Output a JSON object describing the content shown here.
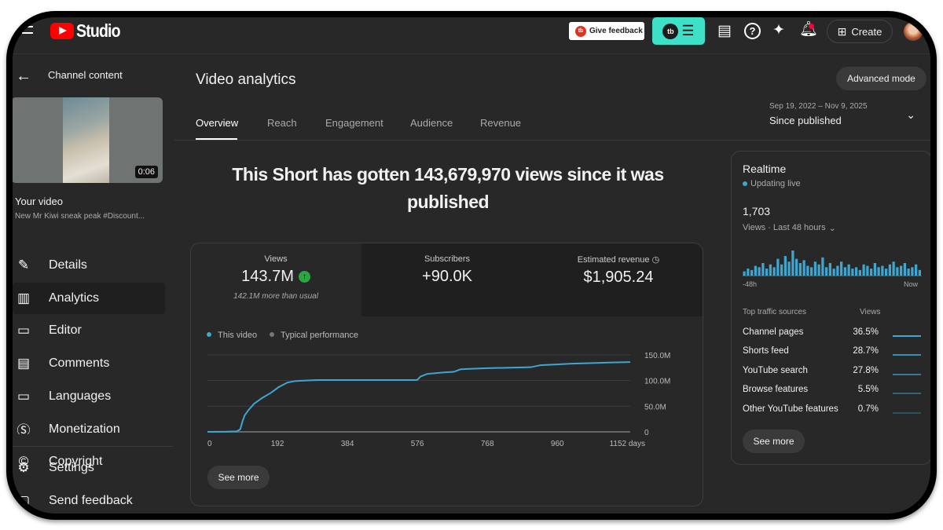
{
  "header": {
    "app_name": "Studio",
    "give_feedback": "Give feedback",
    "create": "Create",
    "tubebuddy": "tb"
  },
  "sidebar": {
    "back_label": "Channel content",
    "video_duration": "0:06",
    "your_video": "Your video",
    "video_title": "New Mr Kiwi sneak peak #Discount...",
    "items": [
      {
        "label": "Details",
        "icon": "pencil-icon"
      },
      {
        "label": "Analytics",
        "icon": "analytics-icon"
      },
      {
        "label": "Editor",
        "icon": "editor-icon"
      },
      {
        "label": "Comments",
        "icon": "comments-icon"
      },
      {
        "label": "Languages",
        "icon": "subtitles-icon"
      },
      {
        "label": "Monetization",
        "icon": "dollar-icon"
      },
      {
        "label": "Copyright",
        "icon": "copyright-icon"
      }
    ],
    "bottom": [
      {
        "label": "Settings",
        "icon": "gear-icon"
      },
      {
        "label": "Send feedback",
        "icon": "feedback-icon"
      }
    ]
  },
  "main": {
    "title": "Video analytics",
    "advanced_mode": "Advanced mode",
    "tabs": [
      "Overview",
      "Reach",
      "Engagement",
      "Audience",
      "Revenue"
    ],
    "date_range": "Sep 19, 2022 – Nov 9, 2025",
    "date_label": "Since published",
    "headline": "This Short has gotten 143,679,970 views since it was published",
    "kpis": [
      {
        "label": "Views",
        "value": "143.7M",
        "note": "142.1M more than usual"
      },
      {
        "label": "Subscribers",
        "value": "+90.0K"
      },
      {
        "label": "Estimated revenue",
        "value": "$1,905.24"
      }
    ],
    "see_more": "See more"
  },
  "chart_data": {
    "type": "line",
    "legend": [
      "This video",
      "Typical performance"
    ],
    "legend_placement": "top-left",
    "x_ticks": [
      "0",
      "192",
      "384",
      "576",
      "768",
      "960",
      "1152 days"
    ],
    "x_tick_values": [
      0,
      192,
      384,
      576,
      768,
      960,
      1152
    ],
    "xlim": [
      0,
      1160
    ],
    "y_ticks": [
      "0",
      "50.0M",
      "100.0M",
      "150.0M"
    ],
    "y_tick_values": [
      0,
      50,
      100,
      150
    ],
    "ylim": [
      0,
      150
    ],
    "ylabel_units": "M views",
    "series": [
      {
        "name": "This video",
        "color": "#3ea6d0",
        "points": [
          [
            0,
            0
          ],
          [
            50,
            0.3
          ],
          [
            80,
            1
          ],
          [
            90,
            5
          ],
          [
            96,
            20
          ],
          [
            102,
            32
          ],
          [
            112,
            42
          ],
          [
            128,
            55
          ],
          [
            150,
            66
          ],
          [
            174,
            76
          ],
          [
            195,
            87
          ],
          [
            219,
            96
          ],
          [
            240,
            99
          ],
          [
            300,
            101
          ],
          [
            575,
            101
          ],
          [
            585,
            108
          ],
          [
            603,
            113
          ],
          [
            650,
            116
          ],
          [
            676,
            117
          ],
          [
            695,
            122
          ],
          [
            760,
            124
          ],
          [
            887,
            126
          ],
          [
            914,
            130
          ],
          [
            1000,
            133
          ],
          [
            1100,
            135
          ],
          [
            1160,
            136
          ]
        ]
      }
    ]
  },
  "realtime": {
    "title": "Realtime",
    "status": "Updating live",
    "value": "1,703",
    "period": "Views · Last 48 hours",
    "start": "-48h",
    "end": "Now",
    "bars": [
      3,
      5,
      4,
      7,
      6,
      9,
      5,
      8,
      6,
      12,
      8,
      14,
      10,
      18,
      12,
      9,
      11,
      7,
      6,
      10,
      8,
      13,
      6,
      9,
      5,
      7,
      10,
      6,
      8,
      5,
      6,
      4,
      8,
      7,
      5,
      9,
      6,
      7,
      5,
      8,
      10,
      6,
      7,
      9,
      5,
      6,
      8,
      4
    ],
    "sources_header": "Top traffic sources",
    "views_header": "Views",
    "sources": [
      {
        "name": "Channel pages",
        "pct": "36.5%"
      },
      {
        "name": "Shorts feed",
        "pct": "28.7%"
      },
      {
        "name": "YouTube search",
        "pct": "27.8%"
      },
      {
        "name": "Browse features",
        "pct": "5.5%"
      },
      {
        "name": "Other YouTube features",
        "pct": "0.7%"
      }
    ],
    "see_more": "See more"
  },
  "colors": {
    "accent": "#3ea6d0",
    "background": "#282828",
    "positive": "#2ba640"
  }
}
